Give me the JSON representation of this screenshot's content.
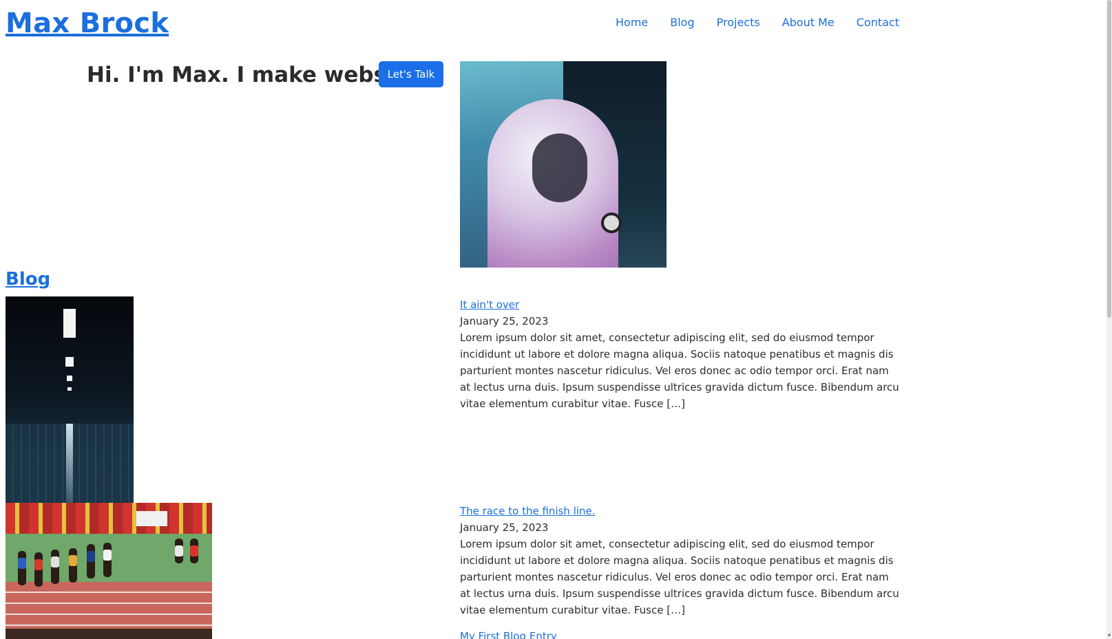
{
  "site": {
    "title": "Max Brock"
  },
  "nav": {
    "items": [
      {
        "label": "Home"
      },
      {
        "label": "Blog"
      },
      {
        "label": "Projects"
      },
      {
        "label": "About Me"
      },
      {
        "label": "Contact"
      }
    ]
  },
  "hero": {
    "headline": "Hi. I'm Max. I make websites.",
    "cta_label": "Let's Talk"
  },
  "blog": {
    "heading": "Blog",
    "posts": [
      {
        "title": "It ain't over",
        "date": "January 25, 2023",
        "excerpt": "Lorem ipsum dolor sit amet, consectetur adipiscing elit, sed do eiusmod tempor incididunt ut labore et dolore magna aliqua. Sociis natoque penatibus et magnis dis parturient montes nascetur ridiculus. Vel eros donec ac odio tempor orci. Erat nam at lectus urna duis. Ipsum suspendisse ultrices gravida dictum fusce. Bibendum arcu vitae elementum curabitur vitae. Fusce […]"
      },
      {
        "title": "The race to the finish line.",
        "date": "January 25, 2023",
        "excerpt": "Lorem ipsum dolor sit amet, consectetur adipiscing elit, sed do eiusmod tempor incididunt ut labore et dolore magna aliqua. Sociis natoque penatibus et magnis dis parturient montes nascetur ridiculus. Vel eros donec ac odio tempor orci. Erat nam at lectus urna duis. Ipsum suspendisse ultrices gravida dictum fusce. Bibendum arcu vitae elementum curabitur vitae. Fusce […]"
      },
      {
        "title": "My First Blog Entry"
      }
    ]
  },
  "colors": {
    "link": "#1a6fdc",
    "button": "#1a6fe8",
    "text": "#2b2b2b"
  }
}
